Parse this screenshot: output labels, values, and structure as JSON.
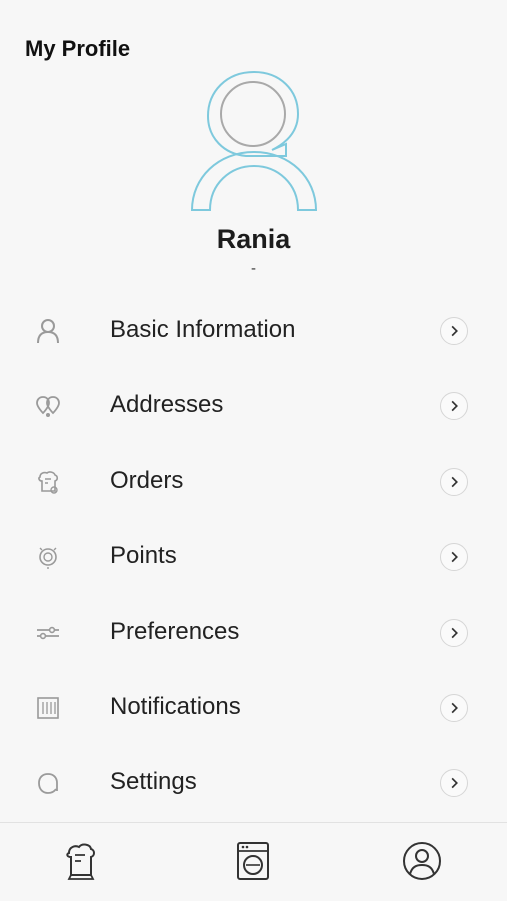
{
  "header": {
    "title": "My Profile"
  },
  "profile": {
    "name": "Rania",
    "subtitle": "-"
  },
  "menu": [
    {
      "label": "Basic Information",
      "icon": "user-icon"
    },
    {
      "label": "Addresses",
      "icon": "location-pins-icon"
    },
    {
      "label": "Orders",
      "icon": "laundry-bag-icon"
    },
    {
      "label": "Points",
      "icon": "points-badge-icon"
    },
    {
      "label": "Preferences",
      "icon": "sliders-icon"
    },
    {
      "label": "Notifications",
      "icon": "bell-panel-icon"
    },
    {
      "label": "Settings",
      "icon": "settings-icon"
    }
  ],
  "bottom_nav": [
    {
      "icon": "laundry-bag-icon"
    },
    {
      "icon": "washing-machine-icon"
    },
    {
      "icon": "profile-icon"
    }
  ],
  "colors": {
    "avatar_accent": "#7ec9dd",
    "icon_gray": "#9a9a9a",
    "background": "#f7f7f7"
  }
}
